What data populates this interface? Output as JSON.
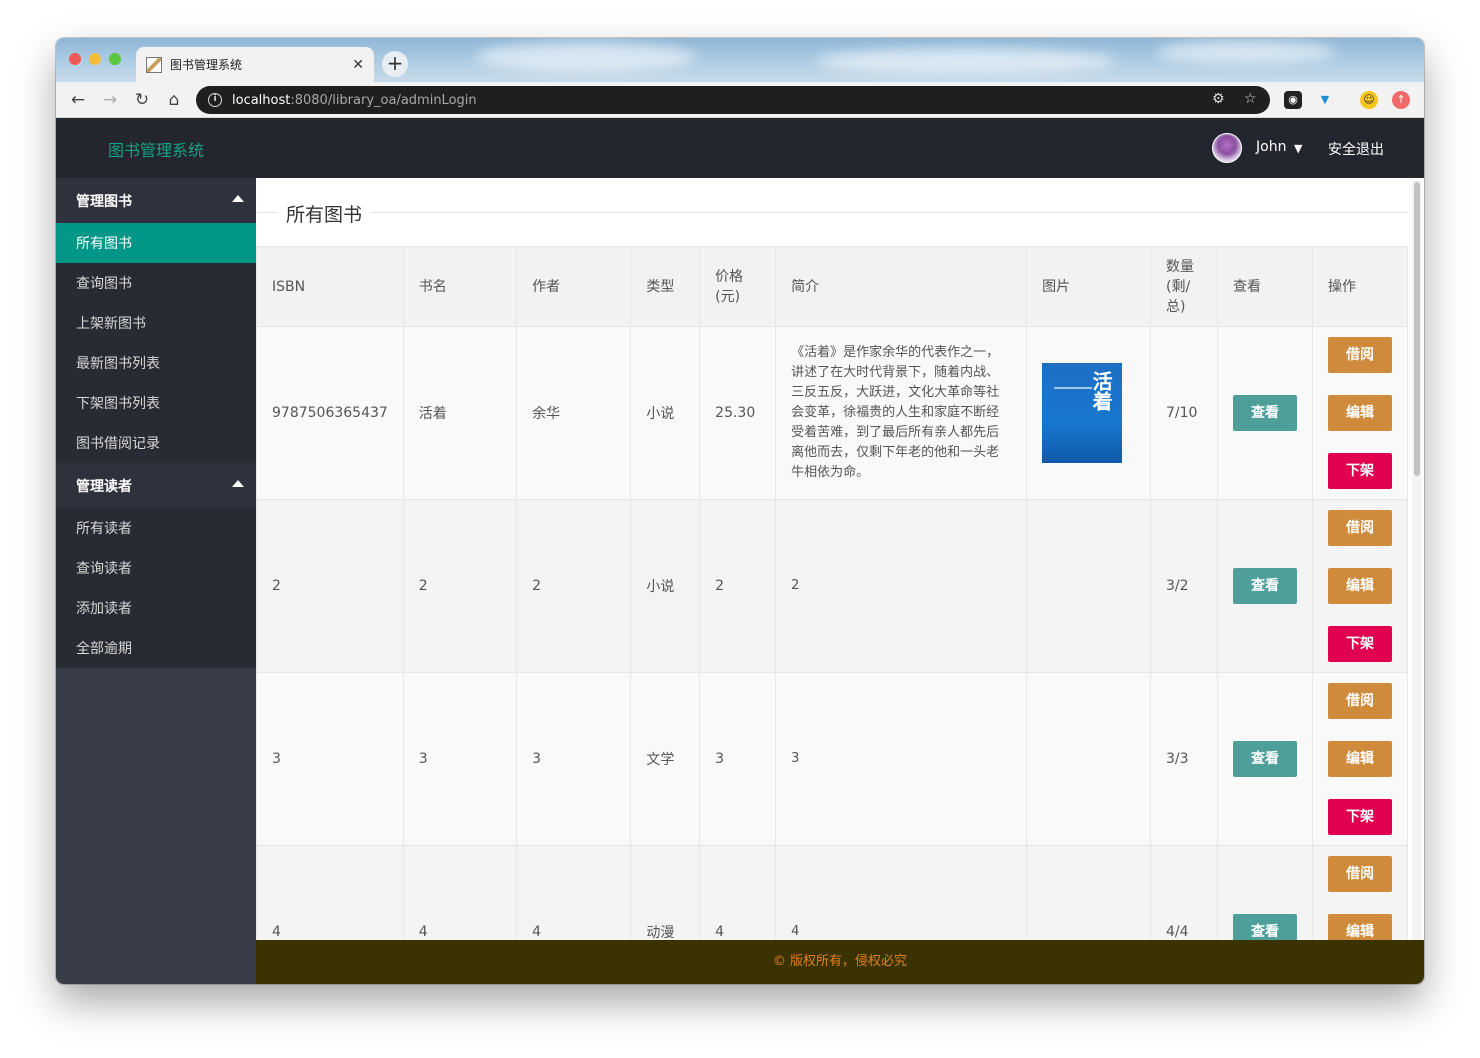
{
  "browser": {
    "tab_title": "图书管理系统",
    "url_host": "localhost",
    "url_path": ":8080/library_oa/adminLogin"
  },
  "header": {
    "brand": "图书管理系统",
    "user_name": "John",
    "logout": "安全退出"
  },
  "sidebar": {
    "groups": [
      {
        "label": "管理图书",
        "items": [
          "所有图书",
          "查询图书",
          "上架新图书",
          "最新图书列表",
          "下架图书列表",
          "图书借阅记录"
        ]
      },
      {
        "label": "管理读者",
        "items": [
          "所有读者",
          "查询读者",
          "添加读者",
          "全部逾期"
        ]
      }
    ],
    "active": "所有图书"
  },
  "main": {
    "legend": "所有图书",
    "columns": [
      "ISBN",
      "书名",
      "作者",
      "类型",
      "价格(元)",
      "简介",
      "图片",
      "数量(剩/总)",
      "查看",
      "操作"
    ],
    "rows": [
      {
        "isbn": "9787506365437",
        "name": "活着",
        "author": "余华",
        "type": "小说",
        "price": "25.30",
        "desc": "《活着》是作家余华的代表作之一，讲述了在大时代背景下，随着内战、三反五反，大跃进，文化大革命等社会变革，徐福贵的人生和家庭不断经受着苦难，到了最后所有亲人都先后离他而去，仅剩下年老的他和一头老牛相依为命。",
        "has_cover": true,
        "cover_text": "活着",
        "qty": "7/10"
      },
      {
        "isbn": "2",
        "name": "2",
        "author": "2",
        "type": "小说",
        "price": "2",
        "desc": "2",
        "has_cover": false,
        "qty": "3/2"
      },
      {
        "isbn": "3",
        "name": "3",
        "author": "3",
        "type": "文学",
        "price": "3",
        "desc": "3",
        "has_cover": false,
        "qty": "3/3"
      },
      {
        "isbn": "4",
        "name": "4",
        "author": "4",
        "type": "动漫",
        "price": "4",
        "desc": "4",
        "has_cover": false,
        "qty": "4/4"
      }
    ],
    "buttons": {
      "view": "查看",
      "borrow": "借阅",
      "edit": "编辑",
      "remove": "下架"
    }
  },
  "footer": {
    "text": "© 版权所有，侵权必究"
  }
}
